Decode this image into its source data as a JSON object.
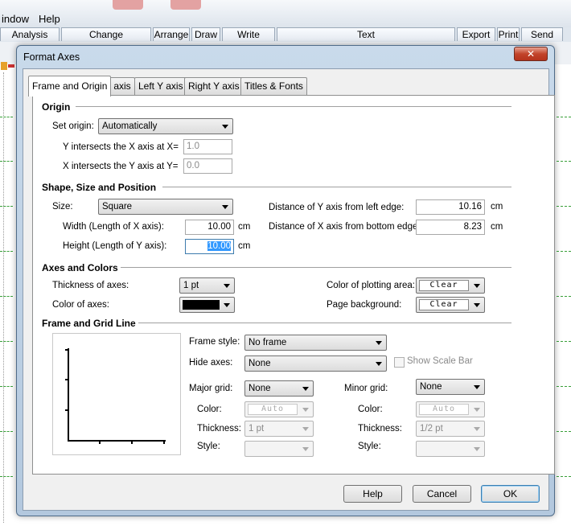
{
  "app": {
    "menu": [
      "indow",
      "Help"
    ],
    "toolbar_groups": [
      "Analysis",
      "Change",
      "Arrange",
      "Draw",
      "Write",
      "Text",
      "Export",
      "Print",
      "Send"
    ]
  },
  "dialog": {
    "title": "Format Axes",
    "close_glyph": "✕",
    "tabs": [
      "Frame and Origin",
      "X axis",
      "Left Y axis",
      "Right Y axis",
      "Titles & Fonts"
    ],
    "origin": {
      "title": "Origin",
      "set_origin_label": "Set origin:",
      "set_origin_value": "Automatically",
      "y_intersect_label": "Y intersects the X axis at X=",
      "y_intersect_value": "1.0",
      "x_intersect_label": "X intersects the Y axis at Y=",
      "x_intersect_value": "0.0"
    },
    "shape": {
      "title": "Shape, Size and Position",
      "size_label": "Size:",
      "size_value": "Square",
      "width_label": "Width (Length of X axis):",
      "width_value": "10.00",
      "width_unit": "cm",
      "height_label": "Height (Length of Y axis):",
      "height_value": "10.00",
      "height_unit": "cm",
      "dist_left_label": "Distance of Y axis from left edge:",
      "dist_left_value": "10.16",
      "dist_left_unit": "cm",
      "dist_bottom_label": "Distance of X axis from bottom edge:",
      "dist_bottom_value": "8.23",
      "dist_bottom_unit": "cm"
    },
    "axes_colors": {
      "title": "Axes and Colors",
      "thickness_label": "Thickness of axes:",
      "thickness_value": "1 pt",
      "color_label": "Color of axes:",
      "color_value": "#000000",
      "plot_area_label": "Color of plotting area:",
      "plot_area_value": "Clear",
      "page_bg_label": "Page background:",
      "page_bg_value": "Clear"
    },
    "frame_grid": {
      "title": "Frame and Grid Line",
      "frame_style_label": "Frame style:",
      "frame_style_value": "No frame",
      "hide_axes_label": "Hide axes:",
      "hide_axes_value": "None",
      "show_scale_bar_label": "Show Scale Bar",
      "major_grid_label": "Major grid:",
      "major_grid_value": "None",
      "minor_grid_label": "Minor grid:",
      "minor_grid_value": "None",
      "color_label": "Color:",
      "major_color_value": "Auto",
      "minor_color_value": "Auto",
      "thickness_label": "Thickness:",
      "major_thickness_value": "1 pt",
      "minor_thickness_value": "1/2 pt",
      "style_label": "Style:",
      "major_style_value": "",
      "minor_style_value": ""
    },
    "buttons": {
      "help": "Help",
      "cancel": "Cancel",
      "ok": "OK"
    }
  }
}
